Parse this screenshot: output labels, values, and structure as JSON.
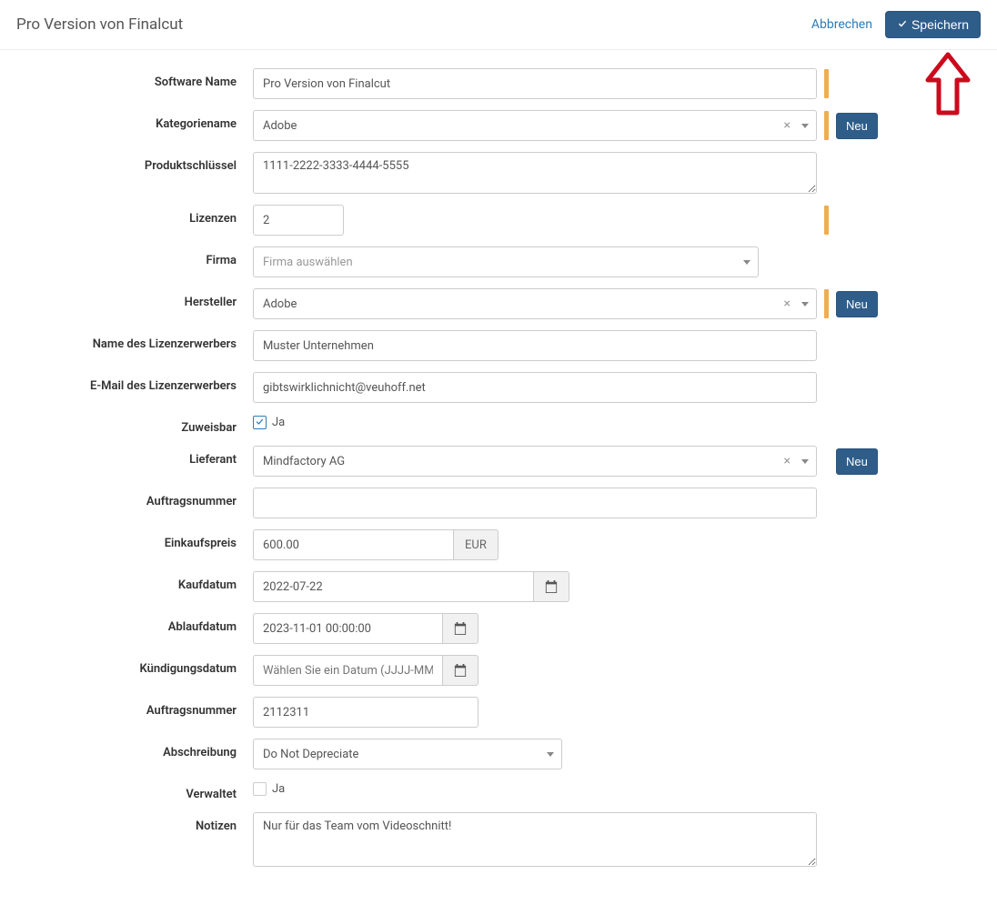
{
  "header": {
    "title": "Pro Version von Finalcut",
    "cancel_label": "Abbrechen",
    "save_label": "Speichern"
  },
  "labels": {
    "software_name": "Software Name",
    "category": "Kategoriename",
    "product_key": "Produktschlüssel",
    "licenses": "Lizenzen",
    "company": "Firma",
    "manufacturer": "Hersteller",
    "licensee_name": "Name des Lizenzerwerbers",
    "licensee_email": "E-Mail des Lizenzerwerbers",
    "assignable": "Zuweisbar",
    "supplier": "Lieferant",
    "order_number": "Auftragsnummer",
    "purchase_price": "Einkaufspreis",
    "purchase_date": "Kaufdatum",
    "expiry_date": "Ablaufdatum",
    "termination_date": "Kündigungsdatum",
    "order_number2": "Auftragsnummer",
    "depreciation": "Abschreibung",
    "managed": "Verwaltet",
    "notes": "Notizen"
  },
  "values": {
    "software_name": "Pro Version von Finalcut",
    "category": "Adobe",
    "product_key": "1111-2222-3333-4444-5555",
    "licenses": "2",
    "company_placeholder": "Firma auswählen",
    "manufacturer": "Adobe",
    "licensee_name": "Muster Unternehmen",
    "licensee_email": "gibtswirklichnicht@veuhoff.net",
    "assignable_yes": "Ja",
    "supplier": "Mindfactory AG",
    "order_number": "",
    "purchase_price": "600.00",
    "currency": "EUR",
    "purchase_date": "2022-07-22",
    "expiry_date": "2023-11-01 00:00:00",
    "termination_placeholder": "Wählen Sie ein Datum (JJJJ-MM-TT)",
    "order_number2": "2112311",
    "depreciation": "Do Not Depreciate",
    "managed_yes": "Ja",
    "notes": "Nur für das Team vom Videoschnitt!"
  },
  "buttons": {
    "new": "Neu"
  }
}
